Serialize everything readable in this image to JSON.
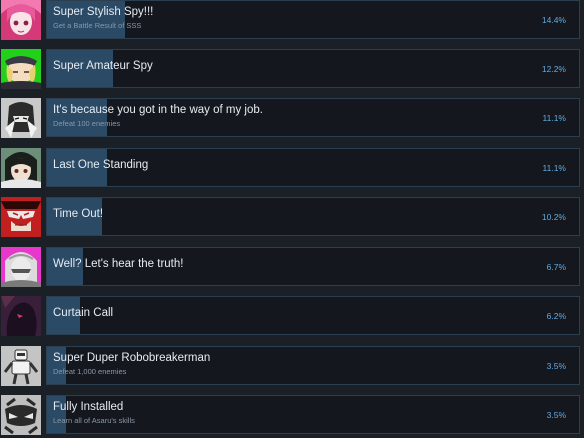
{
  "achievements": [
    {
      "title": "Super Stylish Spy!!!",
      "description": "Get a Battle Result of SSS",
      "percent": "14.4%",
      "progress": 14.4,
      "icon": "pink-haired-girl-icon",
      "icon_bg": "#d43a78"
    },
    {
      "title": "Super Amateur Spy",
      "description": "",
      "percent": "12.2%",
      "progress": 12.2,
      "icon": "blonde-spy-icon",
      "icon_bg": "#22d11a"
    },
    {
      "title": "It's because you got in the way of my job.",
      "description": "Defeat 100 enemies",
      "percent": "11.1%",
      "progress": 11.1,
      "icon": "hooded-ninja-icon",
      "icon_bg": "#c9c9c9"
    },
    {
      "title": "Last One Standing",
      "description": "",
      "percent": "11.1%",
      "progress": 11.1,
      "icon": "dark-haired-girl-icon",
      "icon_bg": "#6d8f7a"
    },
    {
      "title": "Time Out!",
      "description": "",
      "percent": "10.2%",
      "progress": 10.2,
      "icon": "masked-red-character-icon",
      "icon_bg": "#c22020"
    },
    {
      "title": "Well? Let's hear the truth!",
      "description": "",
      "percent": "6.7%",
      "progress": 6.7,
      "icon": "white-haired-character-icon",
      "icon_bg": "#e838cc"
    },
    {
      "title": "Curtain Call",
      "description": "",
      "percent": "6.2%",
      "progress": 6.2,
      "icon": "shadow-figure-icon",
      "icon_bg": "#3a1f3a"
    },
    {
      "title": "Super Duper Robobreakerman",
      "description": "Defeat 1,000 enemies",
      "percent": "3.5%",
      "progress": 3.5,
      "icon": "robot-icon",
      "icon_bg": "#c4c4c4"
    },
    {
      "title": "Fully Installed",
      "description": "Learn all of Asaru's skills",
      "percent": "3.5%",
      "progress": 3.5,
      "icon": "gear-mask-icon",
      "icon_bg": "#bfbfbf"
    }
  ]
}
